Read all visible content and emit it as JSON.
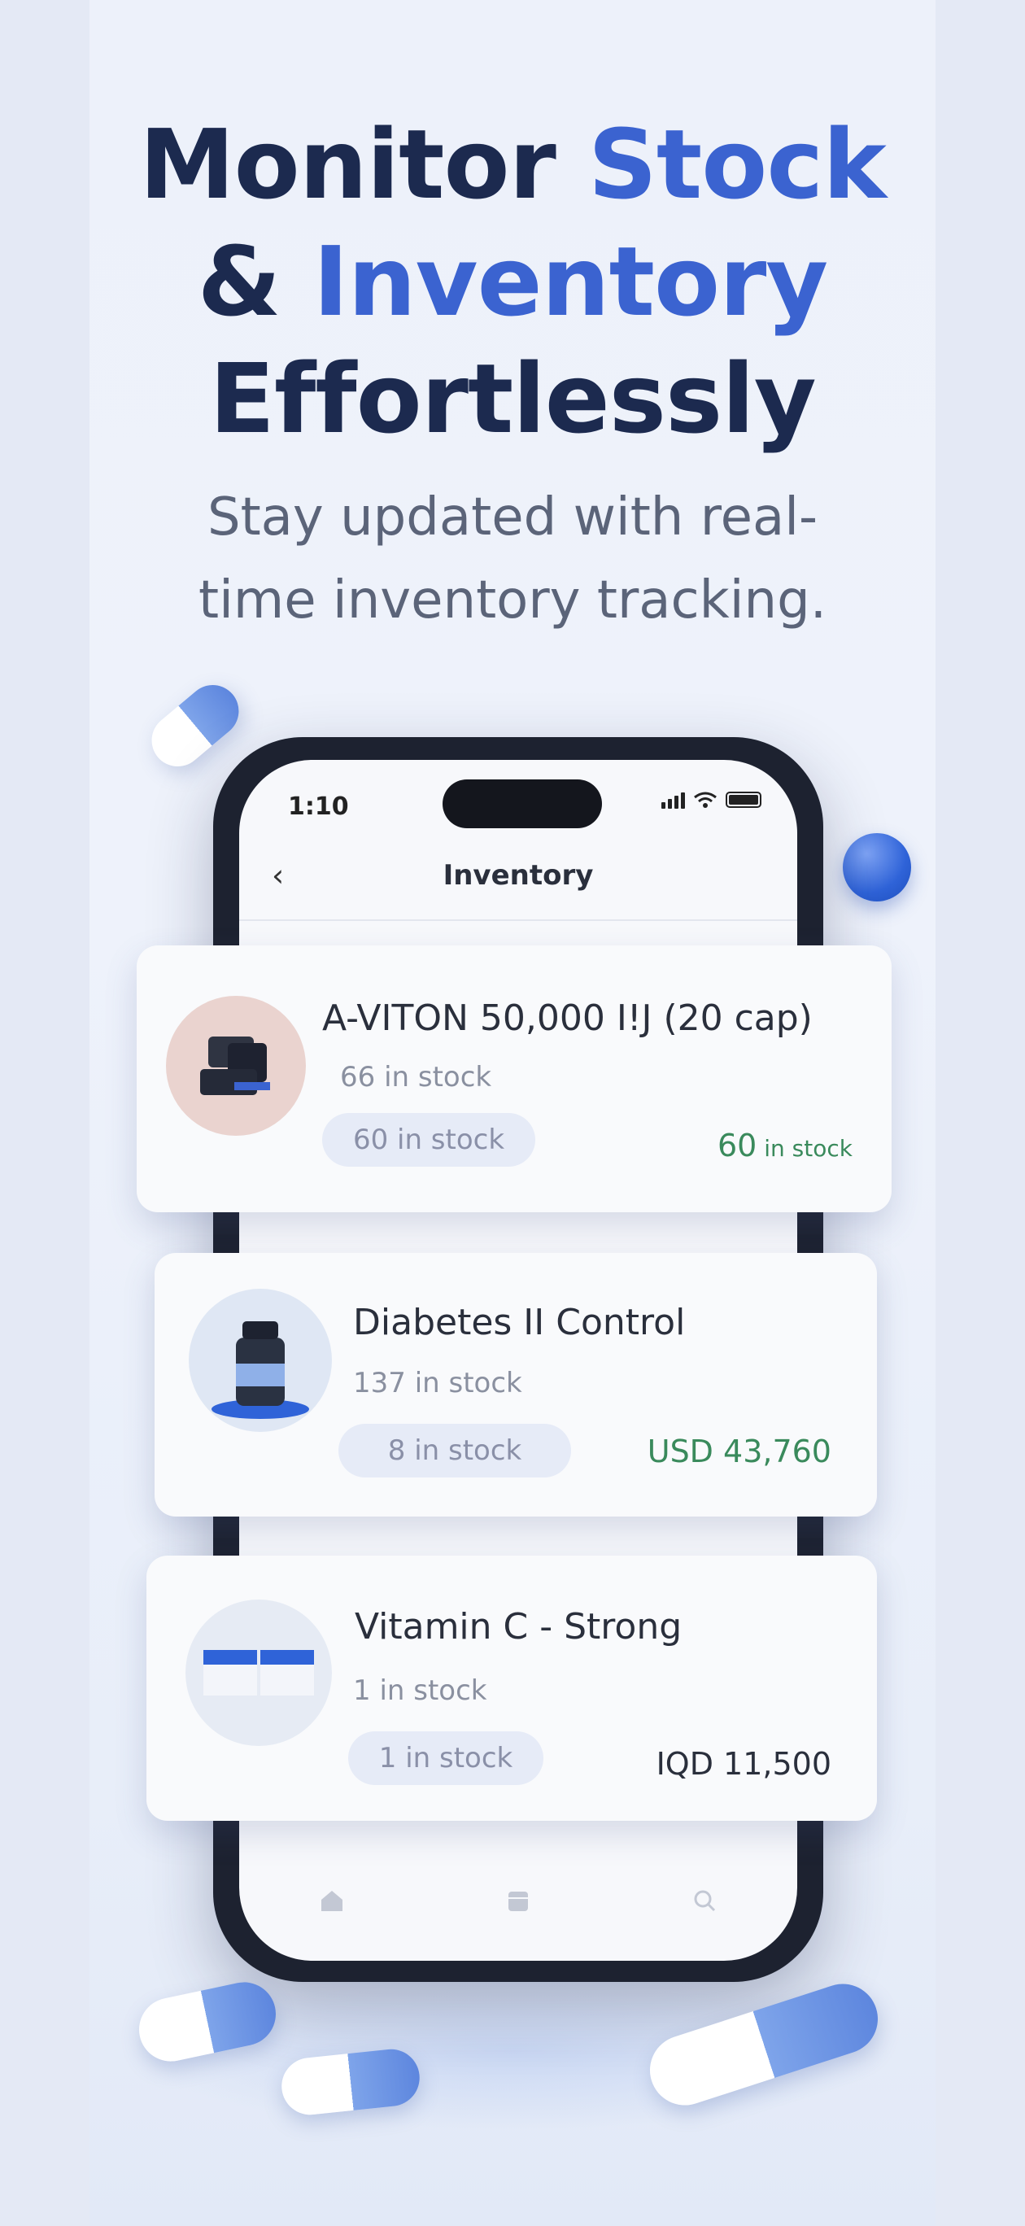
{
  "headline": {
    "line1_a": "Monitor ",
    "line1_b": "Stock",
    "line2_a": "& ",
    "line2_b": "Inventory",
    "line3": "Effortlessly"
  },
  "subline": "Stay updated with real-time inventory tracking.",
  "phone": {
    "status_time": "1:10",
    "back_icon": "chevron-left-icon",
    "title": "Inventory"
  },
  "items": [
    {
      "name": "A-VITON 50,000 I!J (20 cap)",
      "stock": "66 in stock",
      "chip": "60 in stock",
      "price_value": "60",
      "price_suffix": " in stock"
    },
    {
      "name": "Diabetes II Control",
      "stock": "137 in stock",
      "chip": "8 in stock",
      "price": "USD 43,760"
    },
    {
      "name": "Vitamin C - Strong",
      "stock": "1 in stock",
      "chip": "1 in stock",
      "price": "IQD 11,500"
    }
  ],
  "colors": {
    "accent": "#3b63d0",
    "heading": "#1c2a4f",
    "price_green": "#3a8a5c"
  }
}
